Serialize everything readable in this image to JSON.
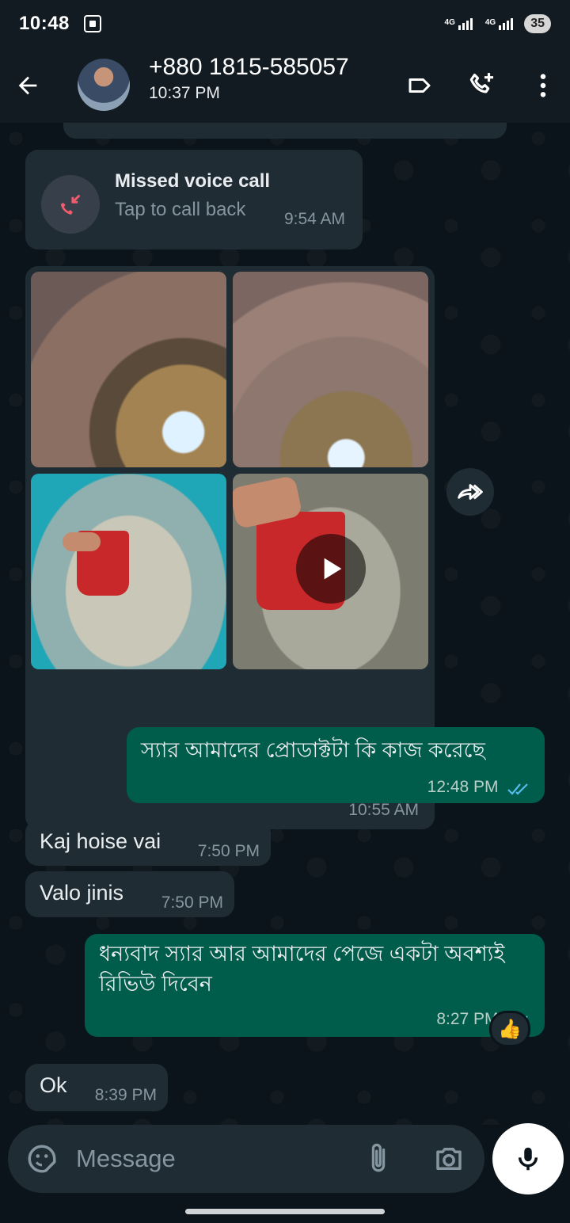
{
  "status_bar": {
    "time": "10:48",
    "net1": "4G",
    "net2": "4G",
    "battery": "35"
  },
  "header": {
    "contact_name": "+880 1815-585057",
    "subtitle": "10:37 PM"
  },
  "missed_call": {
    "title": "Missed voice call",
    "subtitle": "Tap to call back",
    "time": "9:54 AM"
  },
  "media_message": {
    "time": "10:55 AM",
    "items": [
      "photo",
      "photo",
      "photo",
      "video"
    ]
  },
  "messages": [
    {
      "direction": "out",
      "text": "স্যার আমাদের প্রোডাক্টটা কি কাজ করেছে",
      "time": "12:48 PM",
      "status": "read"
    },
    {
      "direction": "in",
      "text": "Kaj hoise vai",
      "time": "7:50 PM"
    },
    {
      "direction": "in",
      "text": "Valo jinis",
      "time": "7:50 PM"
    },
    {
      "direction": "out",
      "text": "ধন্যবাদ স্যার আর আমাদের পেজে একটা অবশ্যই রিভিউ দিবেন",
      "time": "8:27 PM",
      "status": "read",
      "reaction": "👍"
    },
    {
      "direction": "in",
      "text": "Ok",
      "time": "8:39 PM"
    }
  ],
  "composer": {
    "placeholder": "Message"
  },
  "colors": {
    "incoming_bubble": "#1f2c34",
    "outgoing_bubble": "#005c4b",
    "background": "#0b141a",
    "read_ticks": "#53bdeb",
    "missed_call_red": "#f15c6d"
  }
}
